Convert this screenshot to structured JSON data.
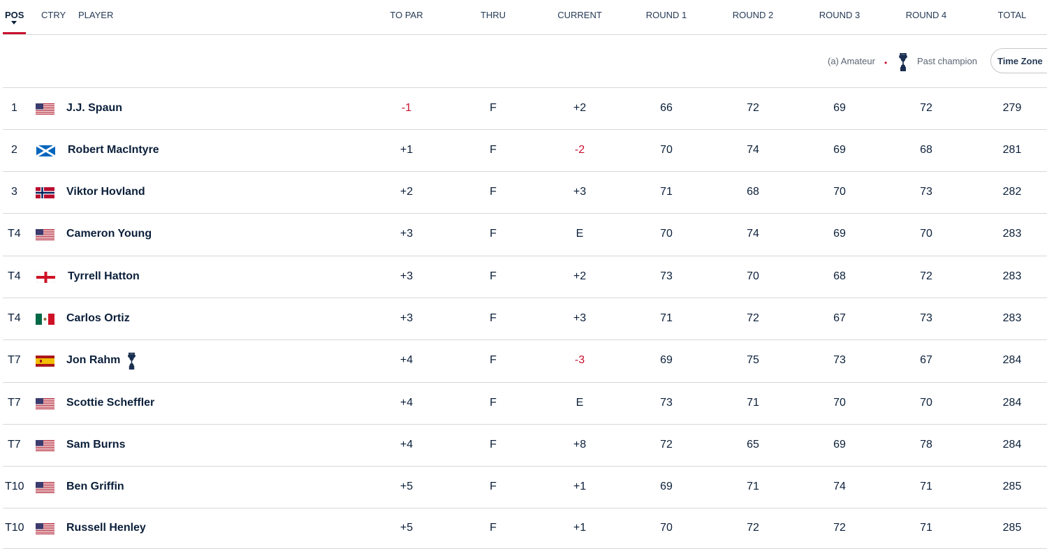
{
  "header": {
    "columns": {
      "pos": "POS",
      "ctry": "CTRY",
      "player": "PLAYER",
      "to_par": "TO PAR",
      "thru": "THRU",
      "current": "CURRENT",
      "round1": "ROUND 1",
      "round2": "ROUND 2",
      "round3": "ROUND 3",
      "round4": "ROUND 4",
      "total": "TOTAL"
    }
  },
  "legend": {
    "amateur": "(a) Amateur",
    "past_champion": "Past champion",
    "time_zone": "Time Zone"
  },
  "colors": {
    "accent_red": "#c8102e",
    "text_navy": "#0b1f3a",
    "divider": "#d8d8d8"
  },
  "players": [
    {
      "pos": "1",
      "flag": "us-flag",
      "name": "J.J. Spaun",
      "to_par": "-1",
      "thru": "F",
      "current": "+2",
      "r1": "66",
      "r2": "72",
      "r3": "69",
      "r4": "72",
      "total": "279",
      "past_champion": false
    },
    {
      "pos": "2",
      "flag": "scotland-flag",
      "name": "Robert MacIntyre",
      "to_par": "+1",
      "thru": "F",
      "current": "-2",
      "r1": "70",
      "r2": "74",
      "r3": "69",
      "r4": "68",
      "total": "281",
      "past_champion": false
    },
    {
      "pos": "3",
      "flag": "norway-flag",
      "name": "Viktor Hovland",
      "to_par": "+2",
      "thru": "F",
      "current": "+3",
      "r1": "71",
      "r2": "68",
      "r3": "70",
      "r4": "73",
      "total": "282",
      "past_champion": false
    },
    {
      "pos": "T4",
      "flag": "us-flag",
      "name": "Cameron Young",
      "to_par": "+3",
      "thru": "F",
      "current": "E",
      "r1": "70",
      "r2": "74",
      "r3": "69",
      "r4": "70",
      "total": "283",
      "past_champion": false
    },
    {
      "pos": "T4",
      "flag": "england-flag",
      "name": "Tyrrell Hatton",
      "to_par": "+3",
      "thru": "F",
      "current": "+2",
      "r1": "73",
      "r2": "70",
      "r3": "68",
      "r4": "72",
      "total": "283",
      "past_champion": false
    },
    {
      "pos": "T4",
      "flag": "mexico-flag",
      "name": "Carlos Ortiz",
      "to_par": "+3",
      "thru": "F",
      "current": "+3",
      "r1": "71",
      "r2": "72",
      "r3": "67",
      "r4": "73",
      "total": "283",
      "past_champion": false
    },
    {
      "pos": "T7",
      "flag": "spain-flag",
      "name": "Jon Rahm",
      "to_par": "+4",
      "thru": "F",
      "current": "-3",
      "r1": "69",
      "r2": "75",
      "r3": "73",
      "r4": "67",
      "total": "284",
      "past_champion": true
    },
    {
      "pos": "T7",
      "flag": "us-flag",
      "name": "Scottie Scheffler",
      "to_par": "+4",
      "thru": "F",
      "current": "E",
      "r1": "73",
      "r2": "71",
      "r3": "70",
      "r4": "70",
      "total": "284",
      "past_champion": false
    },
    {
      "pos": "T7",
      "flag": "us-flag",
      "name": "Sam Burns",
      "to_par": "+4",
      "thru": "F",
      "current": "+8",
      "r1": "72",
      "r2": "65",
      "r3": "69",
      "r4": "78",
      "total": "284",
      "past_champion": false
    },
    {
      "pos": "T10",
      "flag": "us-flag",
      "name": "Ben Griffin",
      "to_par": "+5",
      "thru": "F",
      "current": "+1",
      "r1": "69",
      "r2": "71",
      "r3": "74",
      "r4": "71",
      "total": "285",
      "past_champion": false
    },
    {
      "pos": "T10",
      "flag": "us-flag",
      "name": "Russell Henley",
      "to_par": "+5",
      "thru": "F",
      "current": "+1",
      "r1": "70",
      "r2": "72",
      "r3": "72",
      "r4": "71",
      "total": "285",
      "past_champion": false
    }
  ]
}
